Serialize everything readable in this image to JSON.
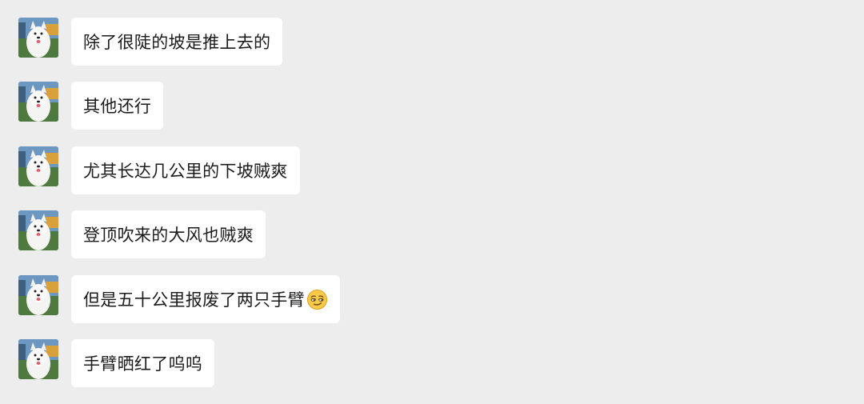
{
  "messages": [
    {
      "text": "除了很陡的坡是推上去的",
      "emoji": null
    },
    {
      "text": "其他还行",
      "emoji": null
    },
    {
      "text": "尤其长达几公里的下坡贼爽",
      "emoji": null
    },
    {
      "text": "登顶吹来的大风也贼爽",
      "emoji": null
    },
    {
      "text": "但是五十公里报废了两只手臂",
      "emoji": "smirk-face-emoji"
    },
    {
      "text": "手臂晒红了呜呜",
      "emoji": null
    }
  ],
  "avatar": {
    "icon": "samoyed-dog-avatar"
  },
  "colors": {
    "background": "#ededed",
    "bubble": "#ffffff",
    "text": "#1b1b1b"
  }
}
